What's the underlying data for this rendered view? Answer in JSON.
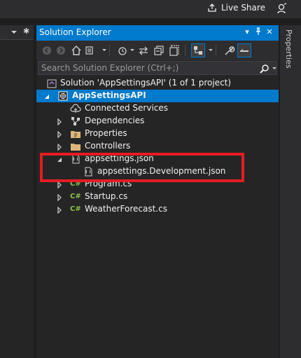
{
  "top_bar": {
    "live_share_label": "Live Share"
  },
  "solution_explorer": {
    "title": "Solution Explorer",
    "search_placeholder": "Search Solution Explorer (Ctrl+;)",
    "tree": {
      "solution_label": "Solution 'AppSettingsAPI' (1 of 1 project)",
      "project_label": "AppSettingsAPI",
      "connected_services_label": "Connected Services",
      "dependencies_label": "Dependencies",
      "properties_label": "Properties",
      "controllers_label": "Controllers",
      "appsettings_label": "appsettings.json",
      "appsettings_dev_label": "appsettings.Development.json",
      "program_label": "Program.cs",
      "startup_label": "Startup.cs",
      "weatherforecast_label": "WeatherForecast.cs"
    }
  },
  "properties_panel": {
    "tab_label": "Properties"
  },
  "colors": {
    "accent": "#007acc",
    "highlight_box": "#e51c23",
    "csharp_icon": "#8bc34a",
    "folder_icon": "#dcb67a"
  }
}
